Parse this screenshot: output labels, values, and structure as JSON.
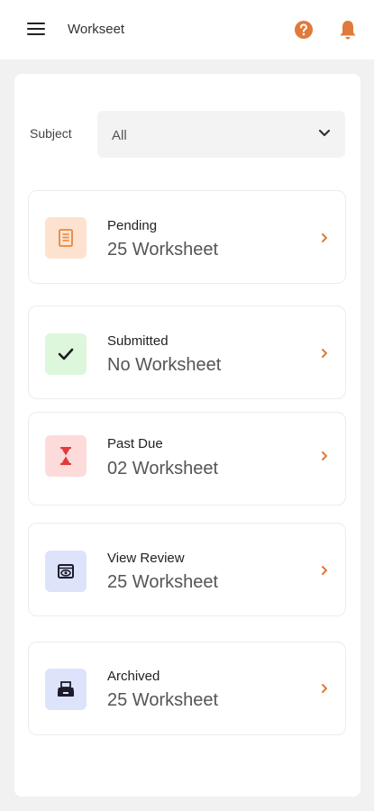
{
  "header": {
    "title": "Workseet",
    "menu_icon": "hamburger-menu-icon",
    "help_icon": "help-circle-icon",
    "notification_icon": "bell-icon",
    "accent_color": "#e07a3a"
  },
  "filter": {
    "label": "Subject",
    "value": "All",
    "chevron_icon": "chevron-down-icon"
  },
  "cards": [
    {
      "title": "Pending",
      "count": "25 Worksheet",
      "icon": "document-icon",
      "icon_bg": "#fde3cf",
      "icon_color": "#e8873f"
    },
    {
      "title": "Submitted",
      "count": "No Worksheet",
      "icon": "checkmark-icon",
      "icon_bg": "#dcf7dc",
      "icon_color": "#1c1c1c"
    },
    {
      "title": "Past Due",
      "count": "02 Worksheet",
      "icon": "hourglass-icon",
      "icon_bg": "#fddbdb",
      "icon_color": "#e23b3b"
    },
    {
      "title": "View Review",
      "count": "25 Worksheet",
      "icon": "eye-review-icon",
      "icon_bg": "#dde3fb",
      "icon_color": "#1c1c2c"
    },
    {
      "title": "Archived",
      "count": "25 Worksheet",
      "icon": "archive-tray-icon",
      "icon_bg": "#dde3fb",
      "icon_color": "#1c1c2c"
    }
  ]
}
